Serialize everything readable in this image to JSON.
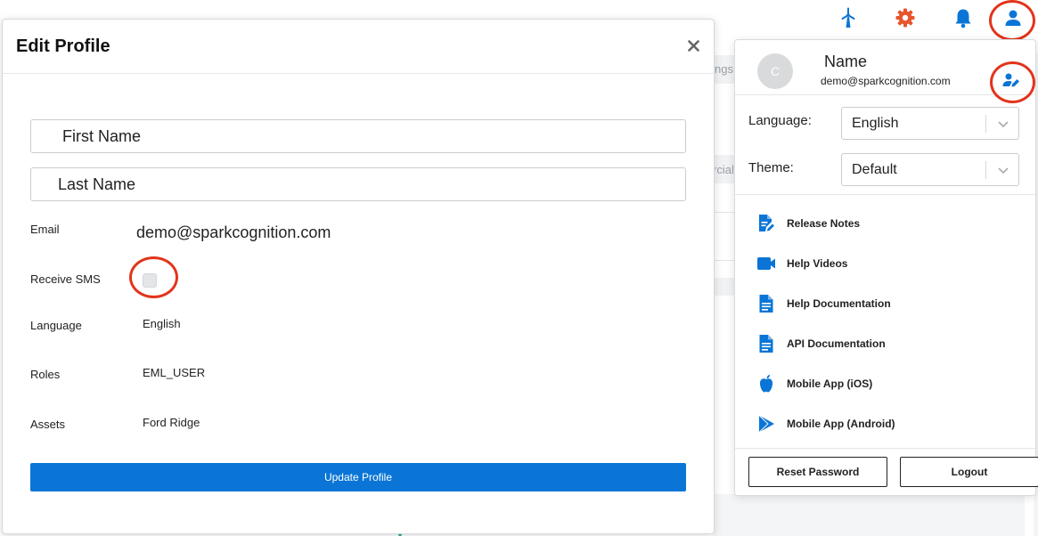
{
  "colors": {
    "accent": "#0a75d6",
    "settings_icon": "#e8542b",
    "highlight_ring": "#e2341b"
  },
  "background": {
    "fragment_1": "ngs",
    "fragment_2": "rcial"
  },
  "toolbar": {
    "icons": [
      "wind-turbine-icon",
      "gear-icon",
      "bell-icon",
      "user-icon"
    ]
  },
  "modal": {
    "title": "Edit Profile",
    "first_name_placeholder": "First Name",
    "last_name_placeholder": "Last Name",
    "email_label": "Email",
    "email_value": "demo@sparkcognition.com",
    "sms_label": "Receive SMS",
    "sms_checked": false,
    "language_label": "Language",
    "language_value": "English",
    "roles_label": "Roles",
    "roles_value": "EML_USER",
    "assets_label": "Assets",
    "assets_value": "Ford Ridge",
    "submit_label": "Update Profile"
  },
  "user_menu": {
    "avatar_initial": "C",
    "name": "Name",
    "email": "demo@sparkcognition.com",
    "language_label": "Language:",
    "language_value": "English",
    "theme_label": "Theme:",
    "theme_value": "Default",
    "links": [
      {
        "label": "Release Notes",
        "icon": "release-notes-icon"
      },
      {
        "label": "Help Videos",
        "icon": "video-camera-icon"
      },
      {
        "label": "Help Documentation",
        "icon": "document-icon"
      },
      {
        "label": "API Documentation",
        "icon": "document-icon"
      },
      {
        "label": "Mobile App (iOS)",
        "icon": "apple-icon"
      },
      {
        "label": "Mobile App (Android)",
        "icon": "play-store-icon"
      }
    ],
    "reset_password_label": "Reset Password",
    "logout_label": "Logout"
  }
}
